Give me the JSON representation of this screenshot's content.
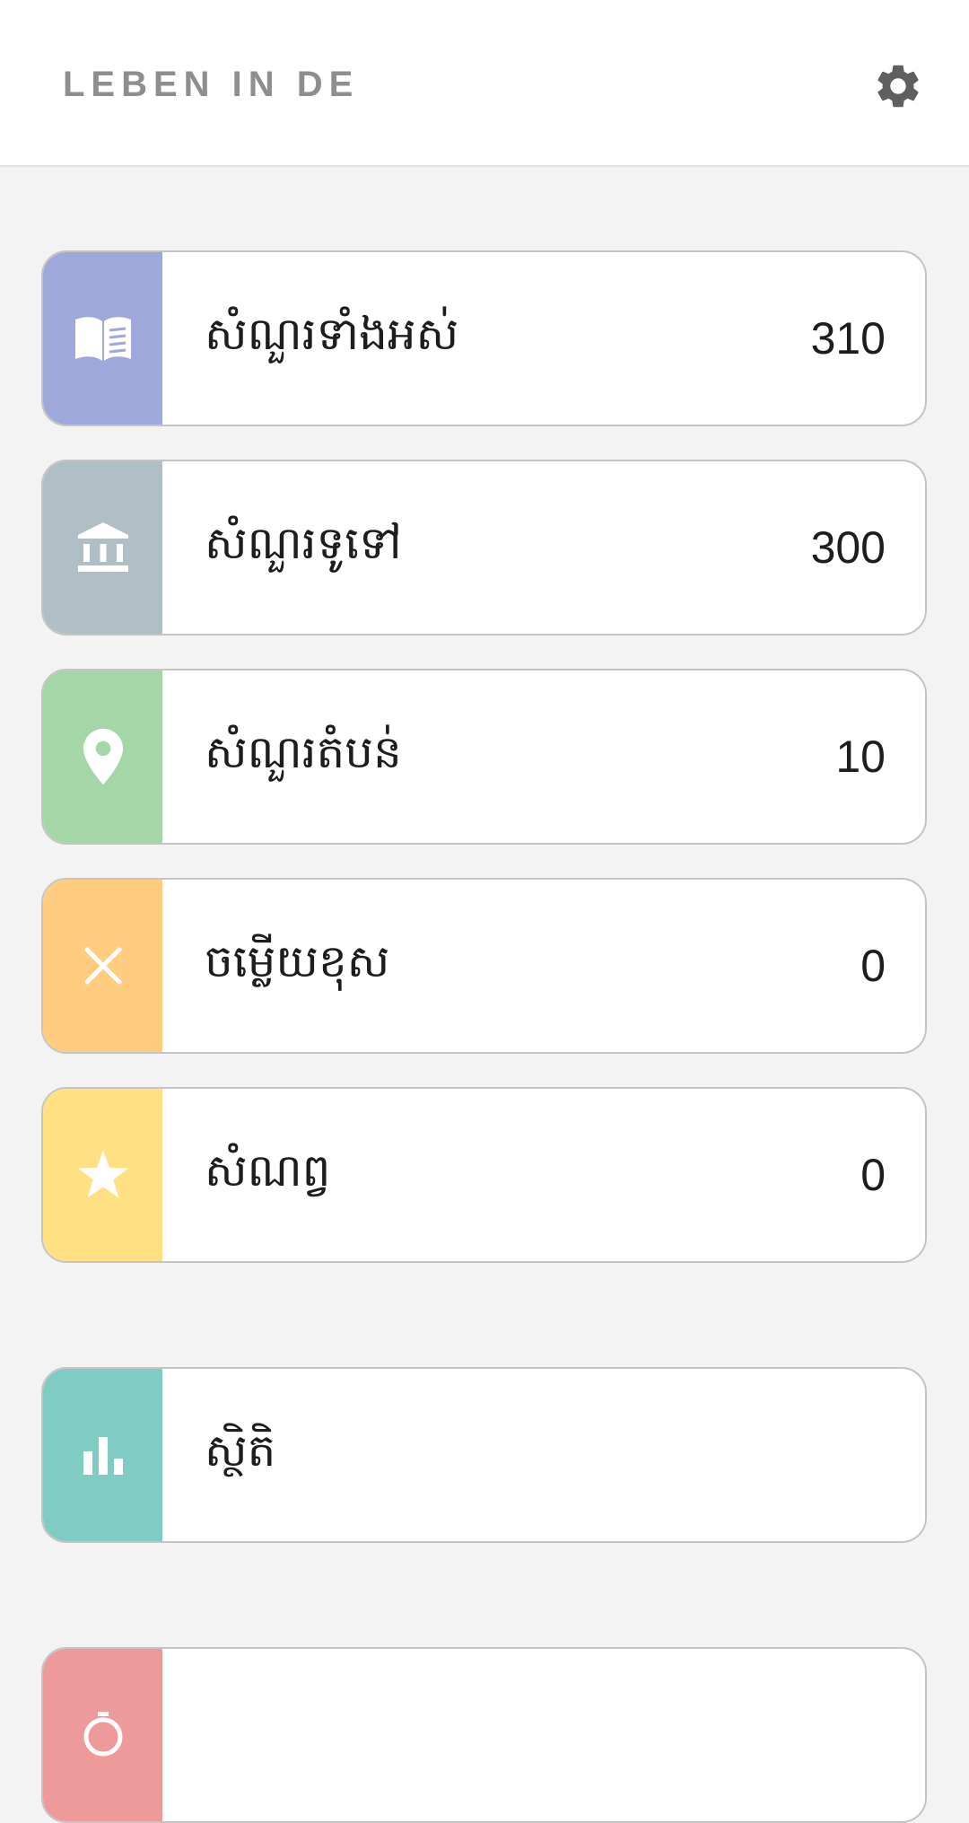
{
  "header": {
    "title": "LEBEN IN DE",
    "settings_icon": "gear-icon"
  },
  "menu": {
    "items": [
      {
        "id": "all-questions",
        "label": "សំណួរទាំងអស់",
        "count": "310",
        "color": "#9fa8da",
        "icon": "book-icon"
      },
      {
        "id": "general-questions",
        "label": "សំណួរទូទៅ",
        "count": "300",
        "color": "#b0bec5",
        "icon": "bank-icon"
      },
      {
        "id": "regional-questions",
        "label": "សំណួរតំបន់",
        "count": "10",
        "color": "#a5d6a7",
        "icon": "location-pin-icon"
      },
      {
        "id": "wrong-answers",
        "label": "ចម្លើយខុស",
        "count": "0",
        "color": "#ffcc80",
        "icon": "close-icon"
      },
      {
        "id": "favorites",
        "label": "សំណព្វ",
        "count": "0",
        "color": "#ffe082",
        "icon": "star-icon"
      }
    ],
    "statistics": {
      "label": "ស្ថិតិ",
      "color": "#80cbc4",
      "icon": "bar-chart-icon"
    },
    "partial": {
      "color": "#ef9a9a",
      "icon": "timer-icon"
    }
  }
}
